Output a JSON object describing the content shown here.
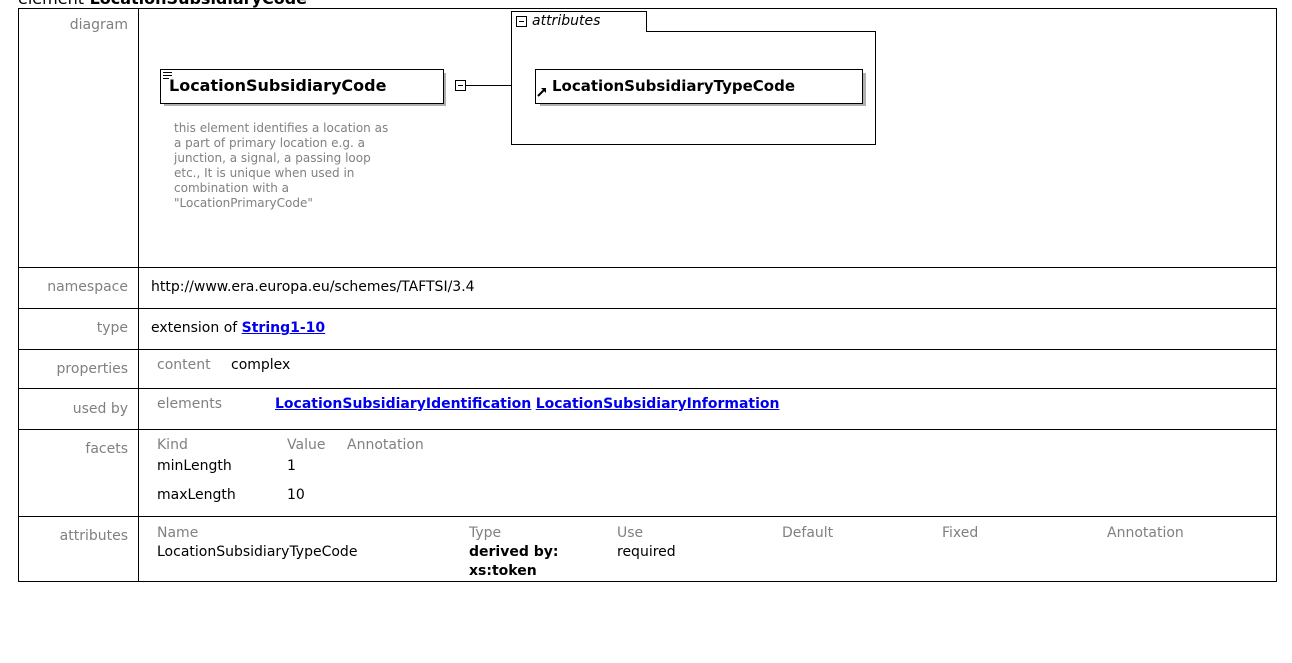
{
  "page": {
    "heading_kw": "element",
    "heading_name": "LocationSubsidiaryCode"
  },
  "rows": {
    "diagram_label": "diagram",
    "namespace_label": "namespace",
    "type_label": "type",
    "properties_label": "properties",
    "used_by_label": "used by",
    "facets_label": "facets",
    "attributes_label": "attributes"
  },
  "diagram": {
    "element_name": "LocationSubsidiaryCode",
    "documentation": "this element identifies a location as a part of primary location e.g. a junction, a signal, a passing loop etc., It is unique when used in combination with a \"LocationPrimaryCode\"",
    "doc_lines": [
      "this element identifies a location as",
      "a part of primary location e.g. a",
      "junction, a signal, a passing loop",
      "etc., It is unique when used in",
      "combination with a",
      "\"LocationPrimaryCode\""
    ],
    "group_label": "attributes",
    "attribute_name": "LocationSubsidiaryTypeCode"
  },
  "namespace": {
    "value": "http://www.era.europa.eu/schemes/TAFTSI/3.4"
  },
  "type": {
    "prefix": "extension of ",
    "link": "String1-10"
  },
  "properties": {
    "key": "content",
    "value": "complex"
  },
  "used_by": {
    "key": "elements",
    "links": [
      "LocationSubsidiaryIdentification",
      "LocationSubsidiaryInformation"
    ]
  },
  "facets": {
    "headers": [
      "Kind",
      "Value",
      "Annotation"
    ],
    "rows": [
      {
        "kind": "minLength",
        "value": "1"
      },
      {
        "kind": "maxLength",
        "value": "10"
      }
    ]
  },
  "attributes": {
    "headers": [
      "Name",
      "Type",
      "Use",
      "Default",
      "Fixed",
      "Annotation"
    ],
    "rows": [
      {
        "name": "LocationSubsidiaryTypeCode",
        "type_line1": "derived by:",
        "type_line2": "xs:token",
        "use": "required",
        "default": "",
        "fixed": "",
        "annotation": ""
      }
    ]
  },
  "colors": {
    "label_gray": "#808080",
    "link_blue": "#0000ee",
    "shadow_gray": "#b0b0b0"
  }
}
